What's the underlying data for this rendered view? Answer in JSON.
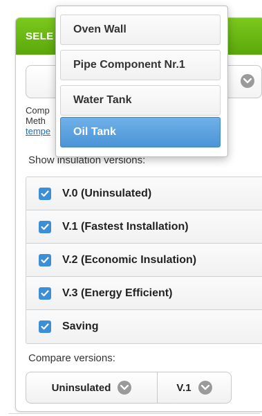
{
  "header": {
    "title": "SELE"
  },
  "compare_text": {
    "line1": "Comp",
    "line1_right": ">",
    "line2": "Meth",
    "link": "tempe"
  },
  "show_label": "Show insulation versions:",
  "versions": [
    {
      "label": "V.0 (Uninsulated)",
      "checked": true
    },
    {
      "label": "V.1 (Fastest Installation)",
      "checked": true
    },
    {
      "label": "V.2 (Economic Insulation)",
      "checked": true
    },
    {
      "label": "V.3 (Energy Efficient)",
      "checked": true
    },
    {
      "label": "Saving",
      "checked": true
    }
  ],
  "compare_label": "Compare versions:",
  "compare": {
    "first": "Uninsulated",
    "second": "V.1"
  },
  "dropdown": {
    "items": [
      "Oven Wall",
      "Pipe Component Nr.1",
      "Water Tank",
      "Oil Tank"
    ],
    "selected": "Oil Tank"
  },
  "colors": {
    "header_green": "#6bb815",
    "checkbox_blue": "#3a8fd8",
    "selected_blue": "#5aa0dc"
  },
  "icons": {
    "chevron": "chevron-down-icon",
    "check": "check-icon"
  }
}
